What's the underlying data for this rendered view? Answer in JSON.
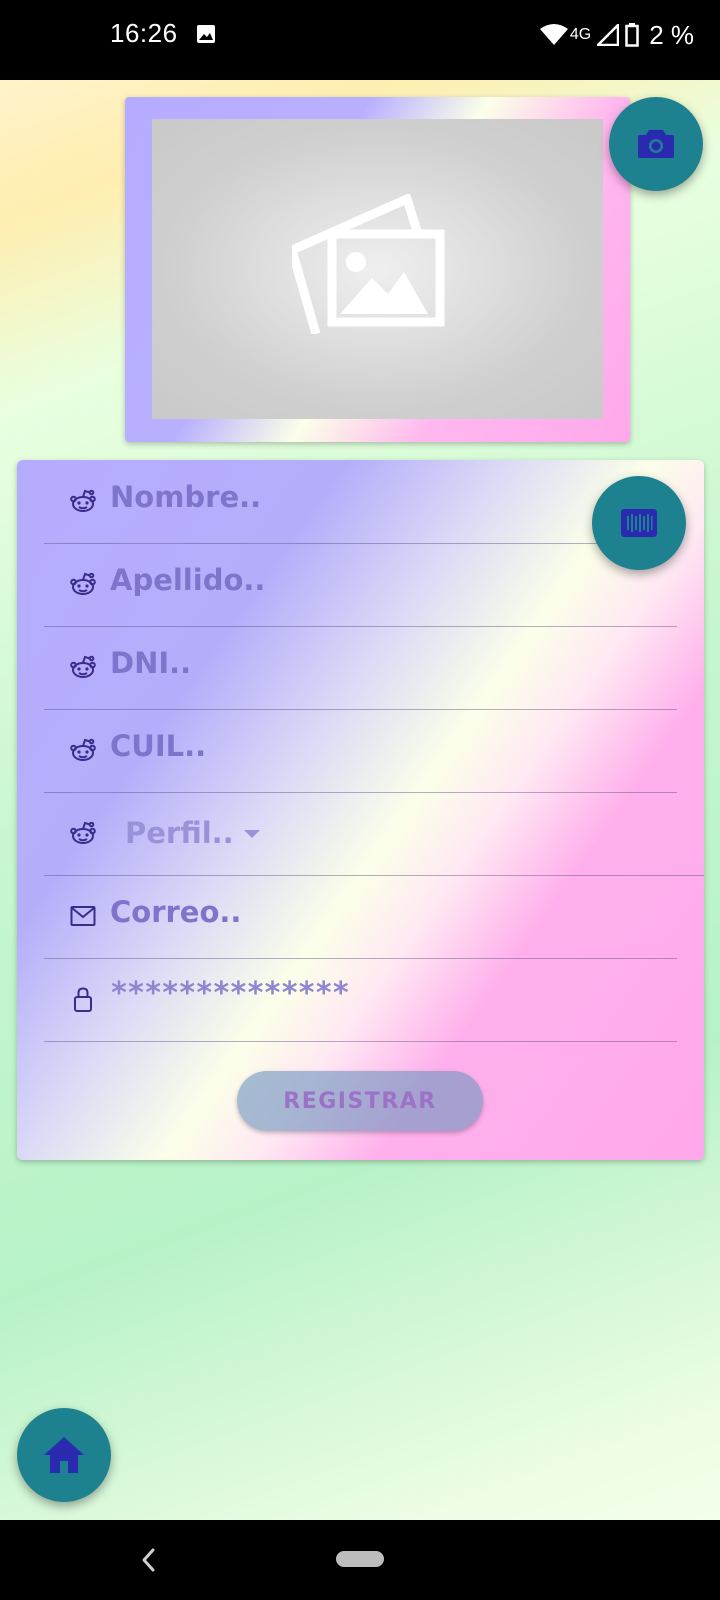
{
  "status_bar": {
    "time": "16:26",
    "network": "4G",
    "battery": "2 %",
    "icons": [
      "image-notification-icon",
      "wifi-icon",
      "signal-icon",
      "battery-icon"
    ]
  },
  "image_card": {
    "icon": "image-placeholder-icon"
  },
  "fabs": {
    "camera_icon": "camera-icon",
    "barcode_icon": "barcode-icon",
    "home_icon": "home-icon"
  },
  "form": {
    "fields": [
      {
        "id": "nombre",
        "placeholder": "Nombre..",
        "icon": "reddit-icon"
      },
      {
        "id": "apellido",
        "placeholder": "Apellido..",
        "icon": "reddit-icon"
      },
      {
        "id": "dni",
        "placeholder": "DNI..",
        "icon": "reddit-icon"
      },
      {
        "id": "cuil",
        "placeholder": "CUIL..",
        "icon": "reddit-icon"
      }
    ],
    "perfil": {
      "placeholder": "Perfil..",
      "icon": "reddit-icon"
    },
    "correo": {
      "placeholder": "Correo..",
      "icon": "mail-icon"
    },
    "password": {
      "value": "**************",
      "icon": "lock-icon"
    },
    "register_label": "REGISTRAR"
  },
  "colors": {
    "fab": "#1e8190",
    "fab_icon": "#2a2ab0",
    "hint_text": "#7f74cc",
    "icon_color": "#3a2c8a"
  }
}
